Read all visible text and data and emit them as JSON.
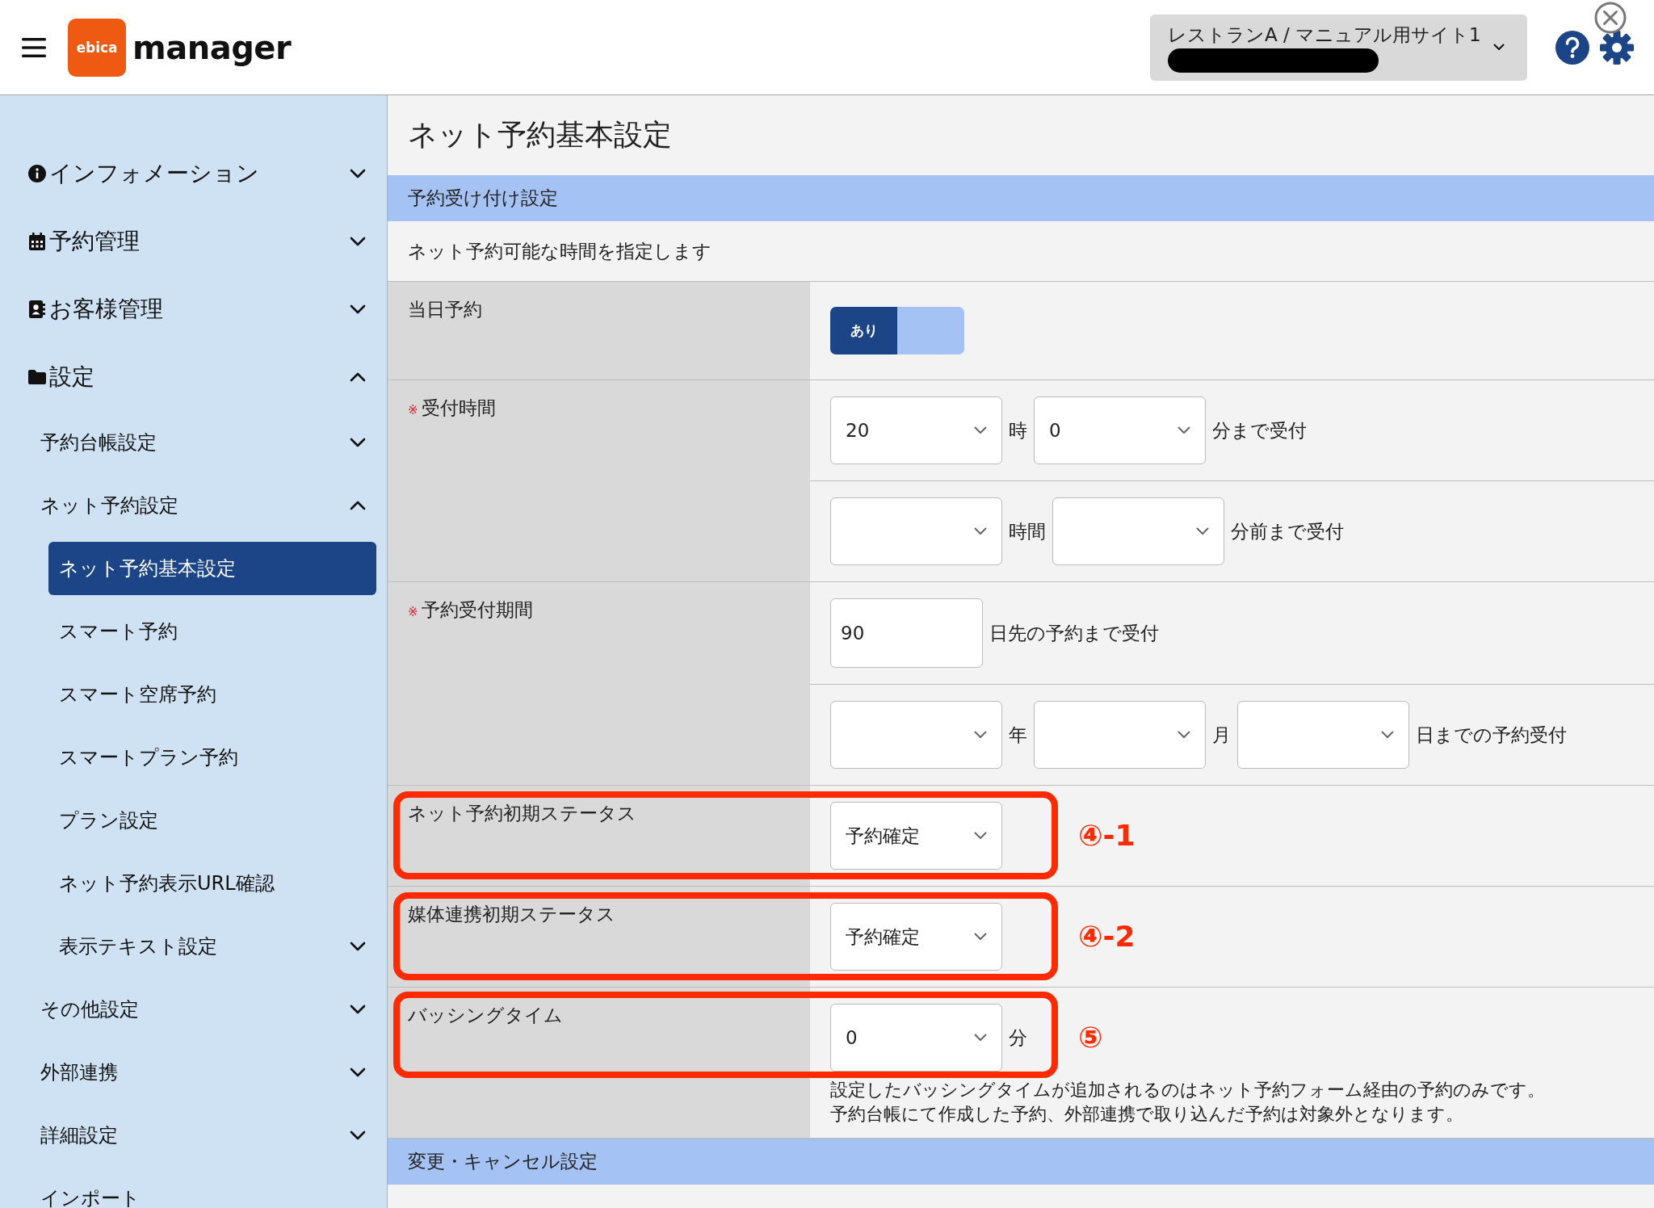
{
  "header": {
    "logo": {
      "badge": "ebica",
      "name": "manager"
    },
    "site_selector": {
      "value": "レストランA / マニュアル用サイト1",
      "redacted": true
    }
  },
  "sidebar": {
    "items": [
      {
        "label": "インフォメーション",
        "expanded": false
      },
      {
        "label": "予約管理",
        "expanded": false
      },
      {
        "label": "お客様管理",
        "expanded": false
      },
      {
        "label": "設定",
        "expanded": true,
        "children": [
          {
            "label": "予約台帳設定",
            "expanded": false
          },
          {
            "label": "ネット予約設定",
            "expanded": true,
            "children": [
              {
                "label": "ネット予約基本設定",
                "selected": true
              },
              {
                "label": "スマート予約",
                "selected": false
              },
              {
                "label": "スマート空席予約",
                "selected": false
              },
              {
                "label": "スマートプラン予約",
                "selected": false
              },
              {
                "label": "プラン設定",
                "selected": false
              },
              {
                "label": "ネット予約表示URL確認",
                "selected": false
              },
              {
                "label": "表示テキスト設定",
                "selected": false,
                "expanded": false
              }
            ]
          },
          {
            "label": "その他設定",
            "expanded": false
          },
          {
            "label": "外部連携",
            "expanded": false
          },
          {
            "label": "詳細設定",
            "expanded": false
          },
          {
            "label": "インポート"
          }
        ]
      }
    ]
  },
  "main": {
    "page_title": "ネット予約基本設定",
    "sections": [
      {
        "title": "予約受け付け設定",
        "description": "ネット予約可能な時間を指定します",
        "rows": [
          {
            "label": "当日予約",
            "lines": [
              [
                {
                  "kind": "toggle",
                  "label": "あり",
                  "on": true
                }
              ]
            ]
          },
          {
            "required_mark": "※",
            "label": "受付時間",
            "lines": [
              [
                {
                  "kind": "select",
                  "value": "20"
                },
                {
                  "kind": "text",
                  "text": "時"
                },
                {
                  "kind": "select",
                  "value": "0"
                },
                {
                  "kind": "text",
                  "text": "分まで受付"
                }
              ],
              [
                {
                  "kind": "select"
                },
                {
                  "kind": "text",
                  "text": "時間"
                },
                {
                  "kind": "select"
                },
                {
                  "kind": "text",
                  "text": "分前まで受付"
                }
              ]
            ]
          },
          {
            "required_mark": "※",
            "label": "予約受付期間",
            "lines": [
              [
                {
                  "kind": "input",
                  "value": "90"
                },
                {
                  "kind": "text",
                  "text": "日先の予約まで受付"
                }
              ],
              [
                {
                  "kind": "select"
                },
                {
                  "kind": "text",
                  "text": "年"
                },
                {
                  "kind": "select"
                },
                {
                  "kind": "text",
                  "text": "月"
                },
                {
                  "kind": "select"
                },
                {
                  "kind": "text",
                  "text": "日までの予約受付"
                }
              ]
            ]
          },
          {
            "label": "ネット予約初期ステータス",
            "annotation": "④-1",
            "lines": [
              [
                {
                  "kind": "select",
                  "value": "予約確定"
                }
              ]
            ]
          },
          {
            "label": "媒体連携初期ステータス",
            "annotation": "④-2",
            "lines": [
              [
                {
                  "kind": "select",
                  "value": "予約確定"
                }
              ]
            ]
          },
          {
            "label": "バッシングタイム",
            "annotation": "⑤",
            "lines": [
              [
                {
                  "kind": "select",
                  "value": "0"
                },
                {
                  "kind": "text",
                  "text": "分"
                }
              ]
            ],
            "note": [
              "設定したバッシングタイムが追加されるのはネット予約フォーム経由の予約のみです。",
              "予約台帳にて作成した予約、外部連携で取り込んだ予約は対象外となります。"
            ]
          }
        ]
      },
      {
        "title": "変更・キャンセル設定"
      }
    ]
  }
}
